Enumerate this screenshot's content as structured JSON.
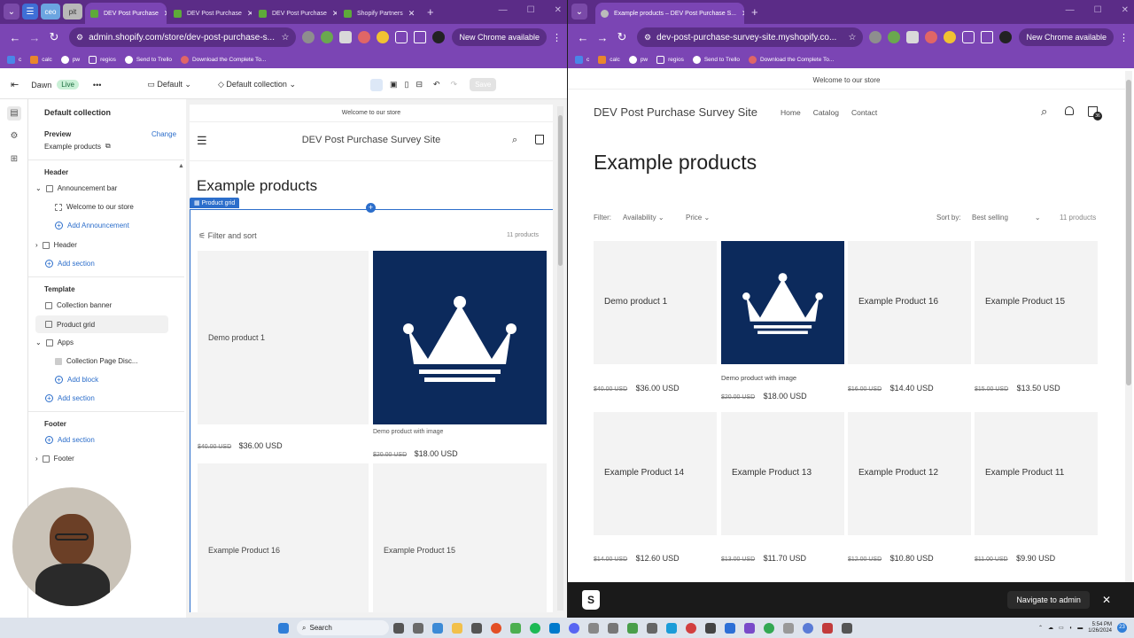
{
  "left_window": {
    "tabs": [
      {
        "label": "DEV Post Purchase",
        "active": true
      },
      {
        "label": "DEV Post Purchase",
        "active": false
      },
      {
        "label": "DEV Post Purchase",
        "active": false
      },
      {
        "label": "Shopify Partners",
        "active": false
      }
    ],
    "pinned": [
      "ceo",
      "pit"
    ],
    "url": "admin.shopify.com/store/dev-post-purchase-s...",
    "chrome_button": "New Chrome available",
    "bookmarks": [
      "c",
      "calc",
      "pw",
      "regios",
      "Send to Trello",
      "Download the Complete To..."
    ],
    "editor": {
      "theme_name": "Dawn",
      "live_badge": "Live",
      "more": "•••",
      "template_select": "Default",
      "collection_select": "Default collection",
      "save_label": "Save",
      "sidebar": {
        "title": "Default collection",
        "preview_label": "Preview",
        "change_label": "Change",
        "preview_value": "Example products",
        "header_group": "Header",
        "announcement_bar": "Announcement bar",
        "announcement_text": "Welcome to our store",
        "add_announcement": "Add Announcement",
        "header_section": "Header",
        "add_section": "Add section",
        "template_group": "Template",
        "collection_banner": "Collection banner",
        "product_grid": "Product grid",
        "apps": "Apps",
        "collection_page_disc": "Collection Page Disc...",
        "add_block": "Add block",
        "footer_group": "Footer",
        "footer_section": "Footer"
      },
      "preview": {
        "announcement": "Welcome to our store",
        "store_name": "DEV Post Purchase Survey Site",
        "collection_title": "Example products",
        "product_grid_tag": "Product grid",
        "filter_sort": "Filter and sort",
        "count": "11 products",
        "products": [
          {
            "name": "Demo product 1",
            "old": "$40.00 USD",
            "price": "$36.00 USD"
          },
          {
            "name": "Demo product with image",
            "old": "$20.00 USD",
            "price": "$18.00 USD"
          },
          {
            "name": "Example Product 16"
          },
          {
            "name": "Example Product 15"
          }
        ]
      }
    }
  },
  "right_window": {
    "tab_label": "Example products – DEV Post Purchase S...",
    "url": "dev-post-purchase-survey-site.myshopify.co...",
    "chrome_button": "New Chrome available",
    "bookmarks": [
      "c",
      "calc",
      "pw",
      "regios",
      "Send to Trello",
      "Download the Complete To..."
    ],
    "store": {
      "announcement": "Welcome to our store",
      "store_name": "DEV Post Purchase Survey Site",
      "nav": [
        "Home",
        "Catalog",
        "Contact"
      ],
      "cart_count": "36",
      "collection_title": "Example products",
      "filter_label": "Filter:",
      "availability": "Availability",
      "price_filter": "Price",
      "sort_label": "Sort by:",
      "sort_value": "Best selling",
      "count": "11 products",
      "products": [
        {
          "name": "Demo product 1",
          "old": "$40.00 USD",
          "price": "$36.00 USD"
        },
        {
          "name": "Demo product with image",
          "old": "$20.00 USD",
          "price": "$18.00 USD"
        },
        {
          "name": "Example Product 16",
          "old": "$16.00 USD",
          "price": "$14.40 USD"
        },
        {
          "name": "Example Product 15",
          "old": "$15.00 USD",
          "price": "$13.50 USD"
        },
        {
          "name": "Example Product 14",
          "old": "$14.00 USD",
          "price": "$12.60 USD"
        },
        {
          "name": "Example Product 13",
          "old": "$13.00 USD",
          "price": "$11.70 USD"
        },
        {
          "name": "Example Product 12",
          "old": "$12.00 USD",
          "price": "$10.80 USD"
        },
        {
          "name": "Example Product 11",
          "old": "$11.00 USD",
          "price": "$9.90 USD"
        }
      ],
      "navigate_admin": "Navigate to admin"
    }
  },
  "taskbar": {
    "search": "Search",
    "time": "5:54 PM",
    "date": "1/26/2024",
    "notif": "23"
  },
  "colors": {
    "chrome_purple": "#7b45b4",
    "tab_purple": "#5b2c87",
    "crown_navy": "#0c2a5c",
    "shopify_blue": "#2c6ecb"
  }
}
